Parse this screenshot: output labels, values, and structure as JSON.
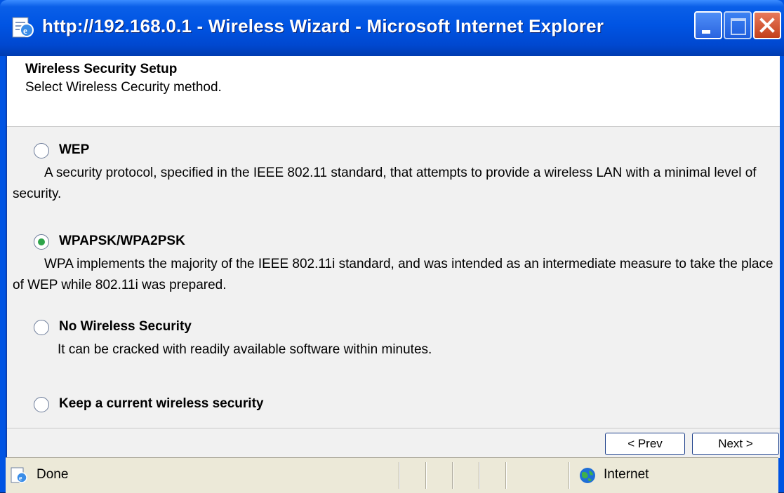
{
  "window": {
    "title": "http://192.168.0.1 - Wireless Wizard - Microsoft Internet Explorer",
    "icon": "ie-page-icon"
  },
  "header": {
    "title": "Wireless Security Setup",
    "subtitle": "Select Wireless Cecurity method."
  },
  "options": [
    {
      "label": "WEP",
      "description": "A security protocol, specified in the IEEE 802.11 standard, that attempts to provide a wireless LAN with a minimal level of security.",
      "selected": false
    },
    {
      "label": "WPAPSK/WPA2PSK",
      "description": "WPA implements the majority of the IEEE 802.11i standard, and was intended as an intermediate measure to take the place of WEP while 802.11i was prepared.",
      "selected": true
    },
    {
      "label": "No Wireless Security",
      "description": "It can be cracked with readily available software within minutes.",
      "selected": false
    },
    {
      "label": "Keep a current wireless security",
      "description": "",
      "selected": false
    }
  ],
  "buttons": {
    "prev": "< Prev",
    "next": "Next >"
  },
  "status": {
    "text": "Done",
    "zone": "Internet"
  },
  "colors": {
    "titlebar": "#0054e3",
    "radio_selected": "#2ea44a",
    "close_button": "#c3401b"
  }
}
